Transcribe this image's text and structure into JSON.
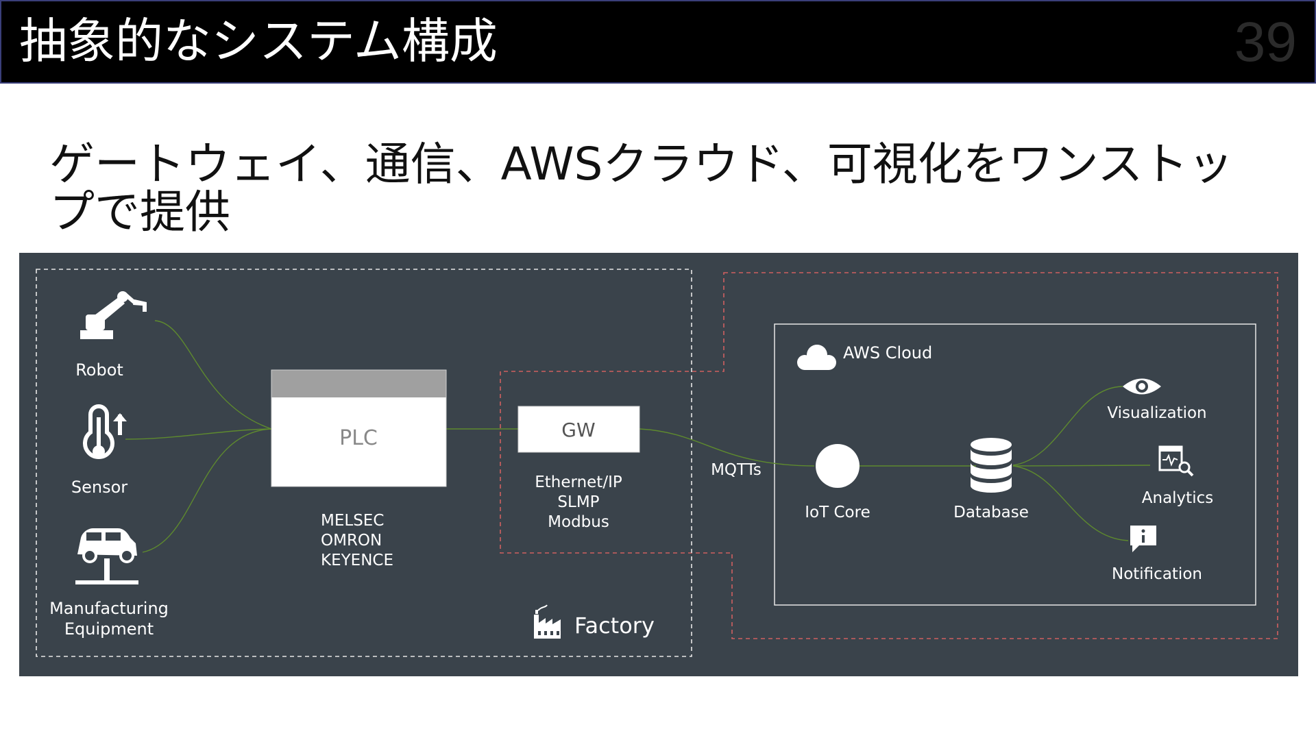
{
  "slide": {
    "title": "抽象的なシステム構成",
    "number": "39",
    "subtitle": "ゲートウェイ、通信、AWSクラウド、可視化をワンストップで提供"
  },
  "colors": {
    "diagram_bg": "#3a434b",
    "connector": "#5e8a2e",
    "factory_border": "#e8e8e8",
    "cloud_border": "#d06060",
    "plc_header": "#a0a0a0"
  },
  "factory": {
    "label": "Factory",
    "devices": [
      {
        "id": "robot",
        "label": "Robot",
        "icon": "robot-arm-icon"
      },
      {
        "id": "sensor",
        "label": "Sensor",
        "icon": "thermometer-icon"
      },
      {
        "id": "equipment",
        "label": "Manufacturing\nEquipment",
        "icon": "car-lift-icon"
      }
    ],
    "plc": {
      "label": "PLC",
      "vendors": [
        "MELSEC",
        "OMRON",
        "KEYENCE"
      ]
    },
    "gateway": {
      "label": "GW",
      "protocols": [
        "Ethernet/IP",
        "SLMP",
        "Modbus"
      ]
    }
  },
  "link": {
    "protocol": "MQTTs"
  },
  "cloud": {
    "label": "AWS Cloud",
    "icon": "cloud-icon",
    "services": [
      {
        "id": "iot-core",
        "label": "IoT Core",
        "icon": "circle-icon"
      },
      {
        "id": "database",
        "label": "Database",
        "icon": "database-icon"
      }
    ],
    "outputs": [
      {
        "id": "visualization",
        "label": "Visualization",
        "icon": "eye-icon"
      },
      {
        "id": "analytics",
        "label": "Analytics",
        "icon": "analytics-icon"
      },
      {
        "id": "notification",
        "label": "Notification",
        "icon": "notification-icon"
      }
    ]
  }
}
